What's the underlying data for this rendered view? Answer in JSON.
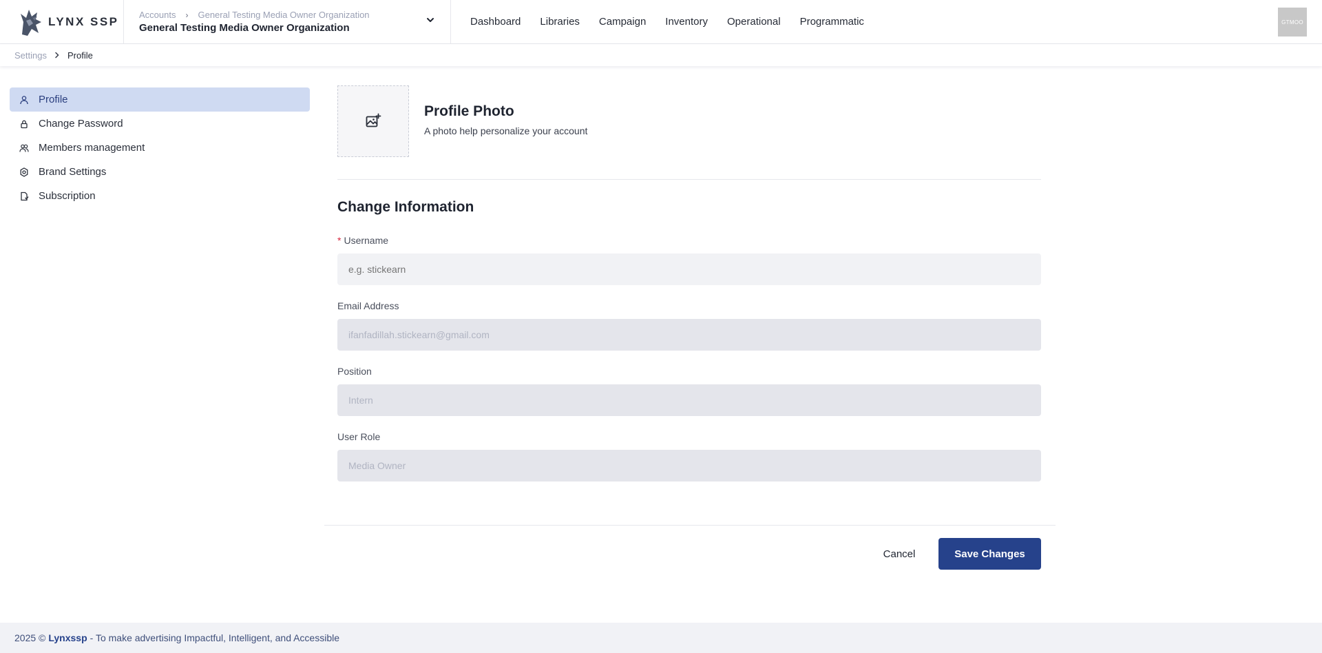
{
  "app": {
    "name": "LYNX SSP"
  },
  "org_switcher": {
    "crumb_root": "Accounts",
    "crumb_org": "General Testing Media Owner Organization",
    "current_org": "General Testing Media Owner Organization"
  },
  "nav": {
    "items": [
      {
        "label": "Dashboard"
      },
      {
        "label": "Libraries"
      },
      {
        "label": "Campaign"
      },
      {
        "label": "Inventory"
      },
      {
        "label": "Operational"
      },
      {
        "label": "Programmatic"
      }
    ]
  },
  "user": {
    "avatar_initials": "GTMOO"
  },
  "breadcrumb": {
    "parent": "Settings",
    "current": "Profile"
  },
  "sidebar": {
    "items": [
      {
        "label": "Profile",
        "icon": "user-icon",
        "active": true
      },
      {
        "label": "Change Password",
        "icon": "lock-icon"
      },
      {
        "label": "Members management",
        "icon": "users-icon"
      },
      {
        "label": "Brand Settings",
        "icon": "gear-icon"
      },
      {
        "label": "Subscription",
        "icon": "document-icon"
      }
    ]
  },
  "profile_photo": {
    "title": "Profile Photo",
    "subtitle": "A photo help personalize your account"
  },
  "form": {
    "title": "Change Information",
    "username": {
      "label": "Username",
      "required_mark": "*",
      "placeholder": "e.g. stickearn"
    },
    "email": {
      "label": "Email Address",
      "value": "ifanfadillah.stickearn@gmail.com"
    },
    "position": {
      "label": "Position",
      "value": "Intern"
    },
    "role": {
      "label": "User Role",
      "value": "Media Owner"
    }
  },
  "actions": {
    "cancel": "Cancel",
    "save": "Save Changes"
  },
  "footer": {
    "prefix": "2025 ©",
    "brand": "Lynxssp",
    "tagline": "- To make advertising Impactful, Intelligent, and Accessible"
  },
  "colors": {
    "primary": "#26428b",
    "active_sidebar_bg": "#cfdaf2",
    "required": "#d7263d",
    "footer_bg": "#f1f2f6"
  }
}
